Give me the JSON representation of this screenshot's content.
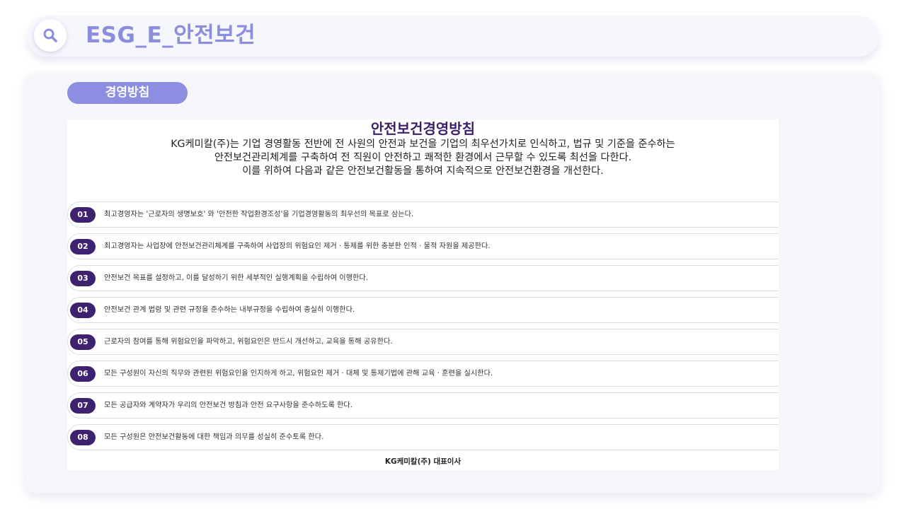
{
  "header": {
    "title": "ESG_E_안전보건",
    "icon": "search-icon",
    "accent_color": "#8b8ddd"
  },
  "section": {
    "label": "경영방침"
  },
  "document": {
    "title": "안전보건경영방침",
    "intro_lines": [
      "KG케미칼(주)는 기업 경영활동 전반에 전 사원의 안전과 보건을 기업의 최우선가치로 인식하고, 법규 및 기준을 준수하는",
      "안전보건관리체계를 구축하여 전 직원이 안전하고 쾌적한 환경에서 근무할 수 있도록 최선을 다한다.",
      "이를 위하여 다음과 같은 안전보건활동을 통하여 지속적으로 안전보건환경을 개선한다."
    ],
    "items": [
      {
        "num": "01",
        "text": "최고경영자는 '근로자의 생명보호' 와 '안전한 작업환경조성'을 기업경영활동의 최우선의 목표로 삼는다."
      },
      {
        "num": "02",
        "text": "최고경영자는 사업장에 안전보건관리체계를 구축하여 사업장의 위험요인 제거 · 통제를 위한 충분한 인적 · 물적 자원을 제공한다."
      },
      {
        "num": "03",
        "text": "안전보건 목표를 설정하고, 이를 달성하기 위한 세부적인 실행계획을 수립하여 이행한다."
      },
      {
        "num": "04",
        "text": "안전보건 관계 법령 및 관련 규정을 준수하는 내부규정을 수립하여 충실히 이행한다."
      },
      {
        "num": "05",
        "text": "근로자의 참여를 통해 위험요인을 파악하고, 위험요인은 반드시 개선하고, 교육을 통해 공유한다."
      },
      {
        "num": "06",
        "text": "모든 구성원이 자신의 직무와 관련된 위험요인을 인지하게 하고, 위험요인 제거 · 대체 및 통제기법에 관해 교육 · 훈련을 실시한다."
      },
      {
        "num": "07",
        "text": "모든 공급자와 계약자가 우리의 안전보건 방침과 안전 요구사항을 준수하도록 한다."
      },
      {
        "num": "08",
        "text": "모든 구성원은 안전보건활동에 대한 책임과 의무를 성실히 준수토록 한다."
      }
    ],
    "signature": "KG케미칼(주) 대표이사"
  }
}
